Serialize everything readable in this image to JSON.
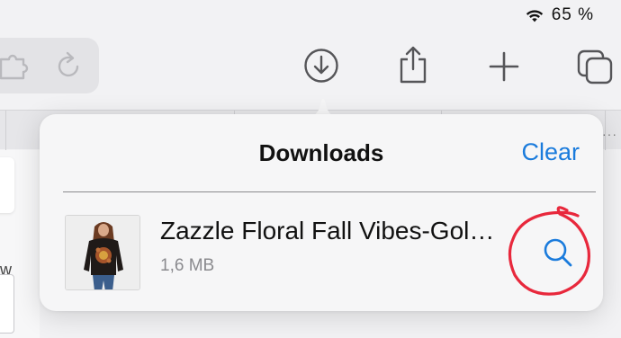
{
  "status_bar": {
    "wifi_icon": "wifi-icon",
    "battery": "65 %"
  },
  "toolbar": {
    "icons": [
      "puzzle-icon",
      "reload-icon",
      "download-icon",
      "share-icon",
      "plus-icon",
      "tabs-icon"
    ]
  },
  "page_background": {
    "partial_text": "w"
  },
  "downloads_popover": {
    "title": "Downloads",
    "clear_label": "Clear",
    "items": [
      {
        "name": "Zazzle Floral Fall Vibes-Gol…",
        "size": "1,6 MB",
        "action_icon": "magnifier-icon"
      }
    ]
  },
  "colors": {
    "accent": "#1a7bdc",
    "annotation": "#e8283c",
    "popover_bg": "#f6f6f7",
    "page_bg": "#f2f2f4"
  }
}
